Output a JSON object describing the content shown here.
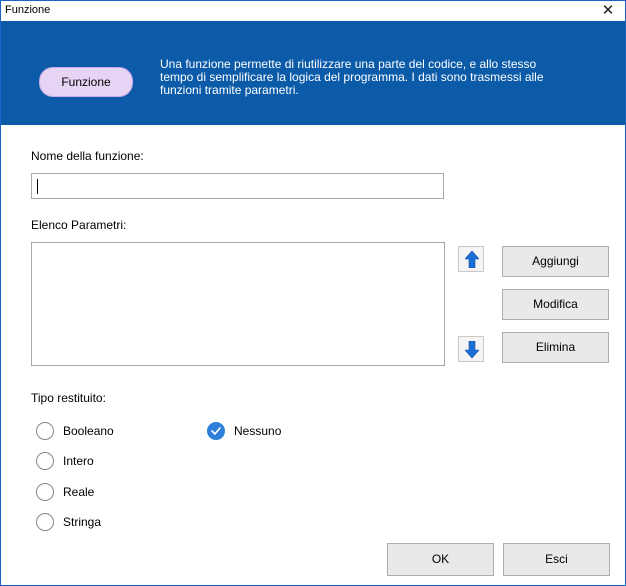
{
  "window": {
    "title": "Funzione",
    "close_glyph": "✕"
  },
  "banner": {
    "pill_label": "Funzione",
    "line1": "Una funzione permette di riutilizzare una parte del codice, e allo stesso",
    "line2": "tempo di semplificare la logica del programma. I dati sono trasmessi alle",
    "line3": "funzioni tramite parametri.",
    "background": "#0b5ba8",
    "pill_color": "#e6d4f5"
  },
  "form": {
    "name_label": "Nome della funzione:",
    "name_value": "",
    "params_label": "Elenco Parametri:",
    "params_items": [],
    "return_label": "Tipo restituito:"
  },
  "buttons": {
    "add": "Aggiungi",
    "edit": "Modifica",
    "delete": "Elimina",
    "ok": "OK",
    "cancel": "Esci",
    "up_icon": "arrow-up-icon",
    "down_icon": "arrow-down-icon"
  },
  "return_types": {
    "selected": "Nessuno",
    "options": [
      "Booleano",
      "Intero",
      "Reale",
      "Stringa",
      "Nessuno"
    ]
  },
  "colors": {
    "accent": "#2e7fd9",
    "arrow": "#1a6fd6",
    "border": "#1a64c8"
  }
}
